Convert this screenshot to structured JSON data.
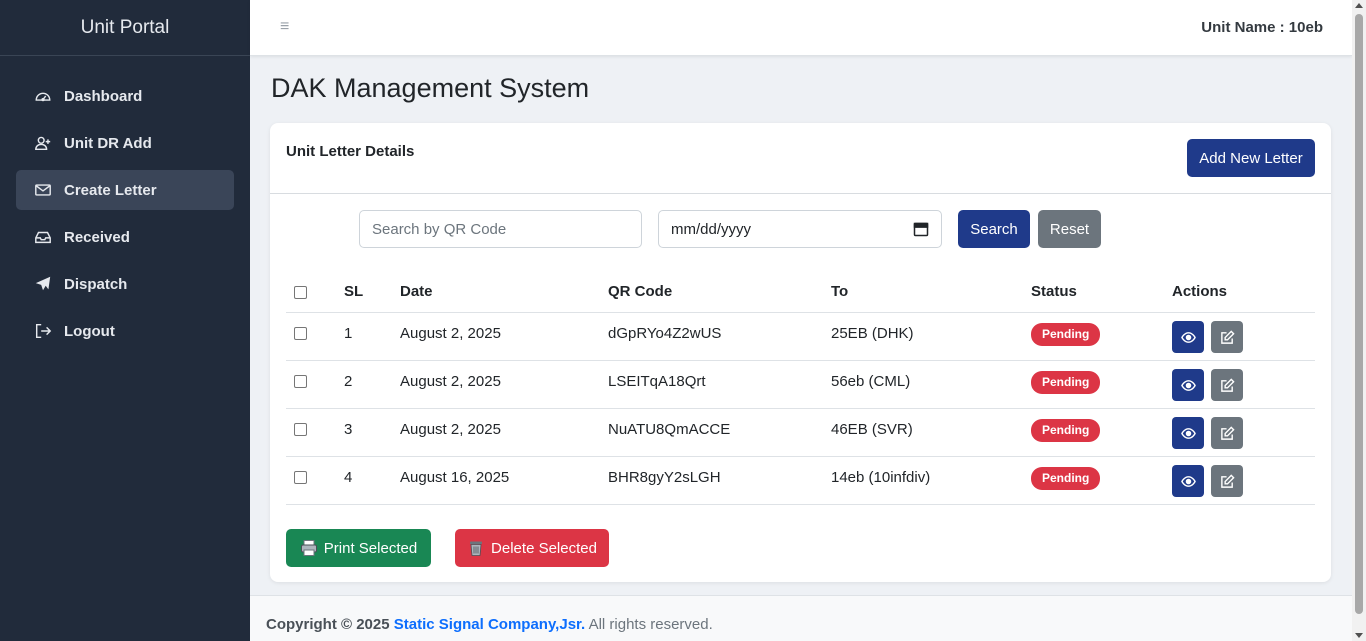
{
  "sidebar": {
    "brand": "Unit Portal",
    "items": [
      {
        "label": "Dashboard",
        "icon": "gauge-icon"
      },
      {
        "label": "Unit DR Add",
        "icon": "user-plus-icon"
      },
      {
        "label": "Create Letter",
        "icon": "envelope-icon"
      },
      {
        "label": "Received",
        "icon": "inbox-icon"
      },
      {
        "label": "Dispatch",
        "icon": "paper-plane-icon"
      },
      {
        "label": "Logout",
        "icon": "sign-out-icon"
      }
    ],
    "active_index": 2
  },
  "topbar": {
    "menu_icon": "≡",
    "unit_name": "Unit Name : 10eb"
  },
  "page": {
    "title": "DAK Management System"
  },
  "card": {
    "title": "Unit Letter Details",
    "add_button": "Add New Letter"
  },
  "filters": {
    "search_placeholder": "Search by QR Code",
    "date_placeholder": "mm/dd/yyyy",
    "search_button": "Search",
    "reset_button": "Reset"
  },
  "table": {
    "headers": {
      "sl": "SL",
      "date": "Date",
      "qr": "QR Code",
      "to": "To",
      "status": "Status",
      "actions": "Actions"
    },
    "rows": [
      {
        "sl": "1",
        "date": "August 2, 2025",
        "qr": "dGpRYo4Z2wUS",
        "to": "25EB (DHK)",
        "status": "Pending"
      },
      {
        "sl": "2",
        "date": "August 2, 2025",
        "qr": "LSEITqA18Qrt",
        "to": "56eb (CML)",
        "status": "Pending"
      },
      {
        "sl": "3",
        "date": "August 2, 2025",
        "qr": "NuATU8QmACCE",
        "to": "46EB (SVR)",
        "status": "Pending"
      },
      {
        "sl": "4",
        "date": "August 16, 2025",
        "qr": "BHR8gyY2sLGH",
        "to": "14eb (10infdiv)",
        "status": "Pending"
      }
    ]
  },
  "bulk_actions": {
    "print": "Print Selected",
    "delete": "Delete Selected"
  },
  "footer": {
    "prefix": "Copyright © 2025",
    "company": "Static Signal Company,Jsr.",
    "suffix": "All rights reserved."
  },
  "colors": {
    "sidebar_bg": "#212b3b",
    "primary": "#1f3a8a",
    "secondary": "#6c757d",
    "success": "#198754",
    "danger": "#dc3545",
    "link": "#0d6efd"
  }
}
